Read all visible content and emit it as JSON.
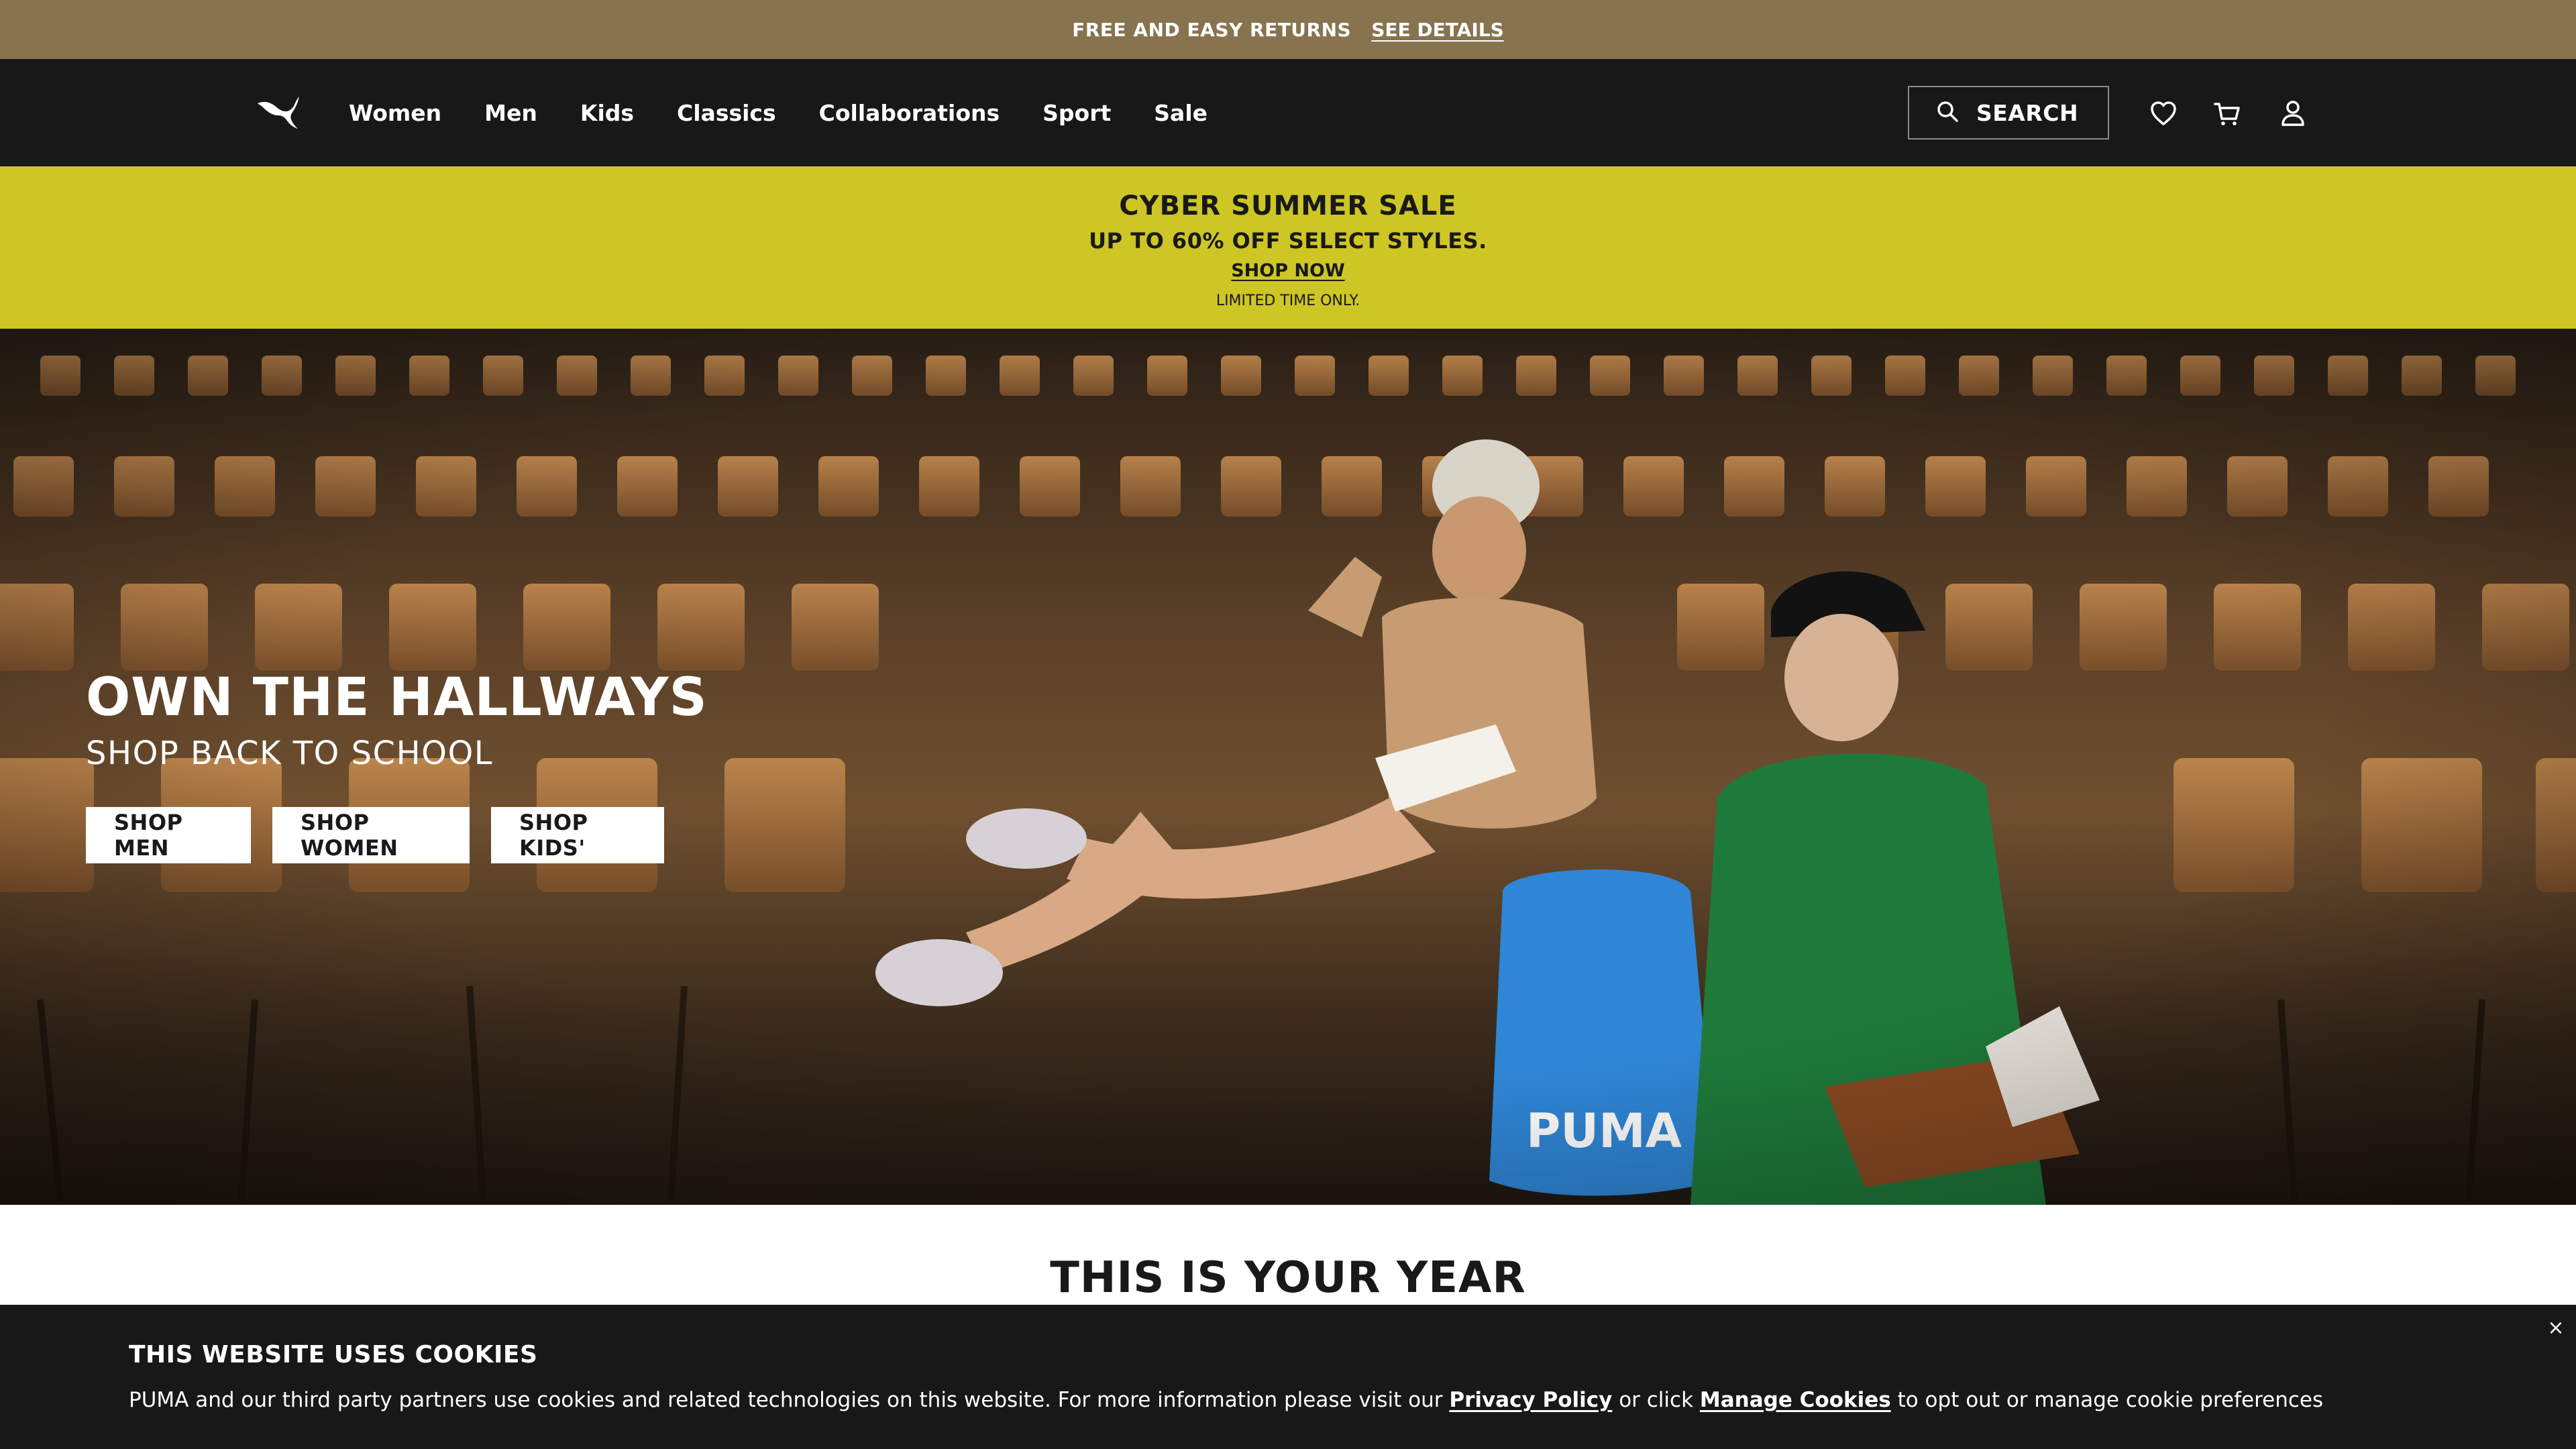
{
  "topbar": {
    "text": "FREE AND EASY RETURNS",
    "link": "SEE DETAILS"
  },
  "nav": {
    "logo": "puma-logo",
    "items": [
      "Women",
      "Men",
      "Kids",
      "Classics",
      "Collaborations",
      "Sport",
      "Sale"
    ],
    "search_label": "SEARCH",
    "icons": [
      "search-icon",
      "heart-icon",
      "cart-icon",
      "user-icon"
    ]
  },
  "sale_banner": {
    "title": "CYBER SUMMER SALE",
    "subtitle": "UP TO 60% OFF SELECT STYLES.",
    "cta": "SHOP NOW",
    "note": "LIMITED TIME ONLY."
  },
  "hero": {
    "title": "OWN THE HALLWAYS",
    "subtitle": "SHOP BACK TO SCHOOL",
    "buttons": [
      "SHOP MEN",
      "SHOP WOMEN",
      "SHOP KIDS'"
    ]
  },
  "section": {
    "title": "THIS IS YOUR YEAR"
  },
  "cookie": {
    "title": "THIS WEBSITE USES COOKIES",
    "text_before": "PUMA and our third party partners use cookies and related technologies on this website. For more information please visit our ",
    "privacy_link": "Privacy Policy",
    "text_middle": " or click ",
    "manage_link": "Manage Cookies",
    "text_after": " to opt out or manage cookie preferences",
    "close": "×"
  },
  "colors": {
    "topbar": "#88734f",
    "nav": "#181818",
    "sale": "#cdc624",
    "cookie": "#181818"
  }
}
